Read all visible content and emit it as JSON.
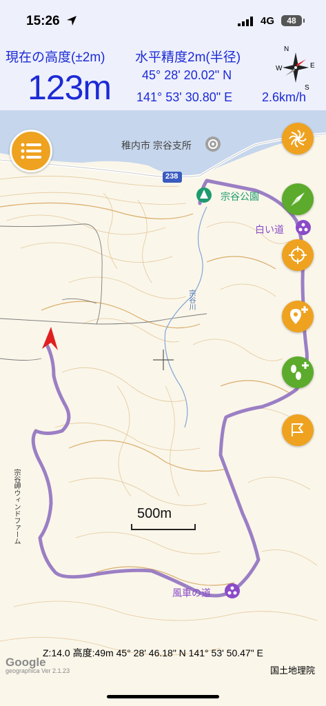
{
  "status_bar": {
    "time": "15:26",
    "network": "4G",
    "battery": "48"
  },
  "info": {
    "altitude_label": "現在の高度(±2m)",
    "altitude_value": "123m",
    "precision_label": "水平精度2m(半径)",
    "latitude": "45° 28' 20.02\" N",
    "longitude": "141° 53' 30.80\" E",
    "speed": "2.6km/h"
  },
  "map": {
    "labels": {
      "city_office": "稚内市 宗谷支所",
      "park": "宗谷公園",
      "shiroi_michi": "白い道",
      "windmill_road": "風車の道",
      "route_number": "238",
      "river": "宗谷川",
      "wind_farm": "宗谷岬ウィンドファーム",
      "scale": "500m"
    },
    "route_color": "#9b7fc4",
    "water_color": "#c6d6ec"
  },
  "buttons": {
    "menu": "menu-icon",
    "layers": "layers-icon",
    "compass": "compass-icon",
    "locate": "crosshair-icon",
    "add_point": "pin-plus-icon",
    "add_track": "footprints-plus-icon",
    "flag": "flag-icon"
  },
  "footer": {
    "readout": "Z:14.0 高度:49m  45° 28' 46.18\" N 141° 53' 50.47\" E",
    "google": "Google",
    "version": "geographica Ver 2.1.23",
    "attribution": "国土地理院"
  }
}
